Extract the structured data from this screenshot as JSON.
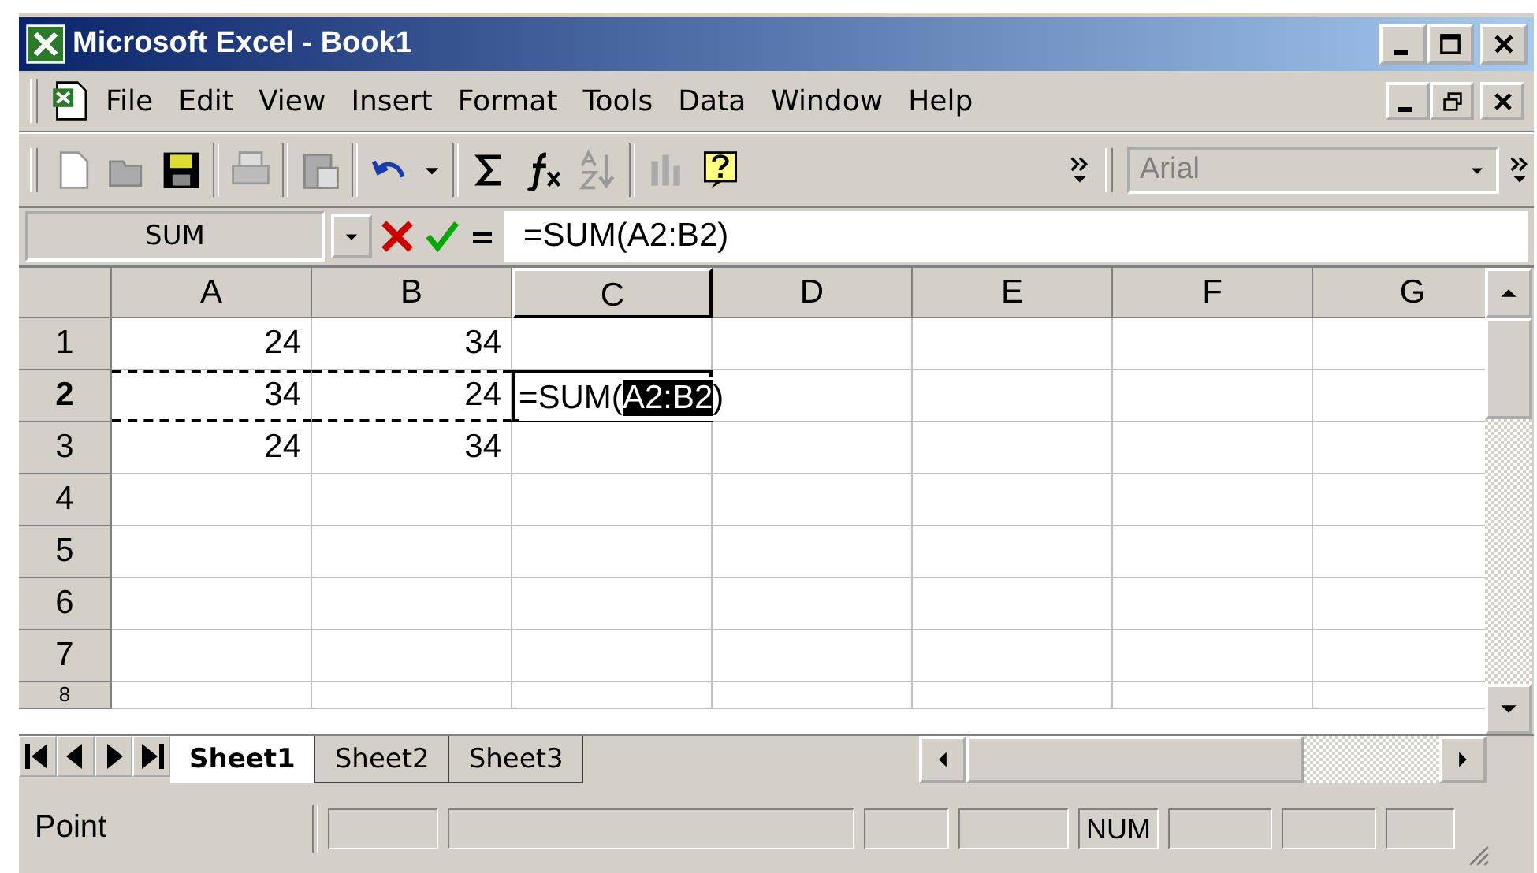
{
  "window": {
    "title": "Microsoft Excel - Book1"
  },
  "menu": [
    "File",
    "Edit",
    "View",
    "Insert",
    "Format",
    "Tools",
    "Data",
    "Window",
    "Help"
  ],
  "font_box": {
    "value": "Arial",
    "disabled": true
  },
  "formula_bar": {
    "name_box": "SUM",
    "formula": "=SUM(A2:B2)"
  },
  "columns": [
    {
      "label": "A",
      "selected": false
    },
    {
      "label": "B",
      "selected": false
    },
    {
      "label": "C",
      "selected": true
    },
    {
      "label": "D",
      "selected": false
    },
    {
      "label": "E",
      "selected": false
    },
    {
      "label": "F",
      "selected": false
    },
    {
      "label": "G",
      "selected": false
    }
  ],
  "rows": [
    {
      "label": "1",
      "selected": false,
      "cells": [
        {
          "value": "24",
          "marquee": false
        },
        {
          "value": "34",
          "marquee": false
        }
      ]
    },
    {
      "label": "2",
      "selected": true,
      "cells": [
        {
          "value": "34",
          "marquee": true
        },
        {
          "value": "24",
          "marquee": true
        }
      ],
      "edit_cell": [
        {
          "text": "=SUM(",
          "highlighted": false
        },
        {
          "text": "A2:B2",
          "highlighted": true
        },
        {
          "text": ")",
          "highlighted": false
        }
      ]
    },
    {
      "label": "3",
      "selected": false,
      "cells": [
        {
          "value": "24",
          "marquee": false
        },
        {
          "value": "34",
          "marquee": false
        }
      ]
    },
    {
      "label": "4",
      "selected": false,
      "cells": []
    },
    {
      "label": "5",
      "selected": false,
      "cells": []
    },
    {
      "label": "6",
      "selected": false,
      "cells": []
    },
    {
      "label": "7",
      "selected": false,
      "cells": []
    },
    {
      "label": "8",
      "selected": false,
      "cells": []
    }
  ],
  "sheet_tabs": [
    {
      "label": "Sheet1",
      "selected": true
    },
    {
      "label": "Sheet2",
      "selected": false
    },
    {
      "label": "Sheet3",
      "selected": false
    }
  ],
  "status_bar": {
    "mode": "Point",
    "indicators": [
      {
        "label": "NUM"
      }
    ]
  }
}
